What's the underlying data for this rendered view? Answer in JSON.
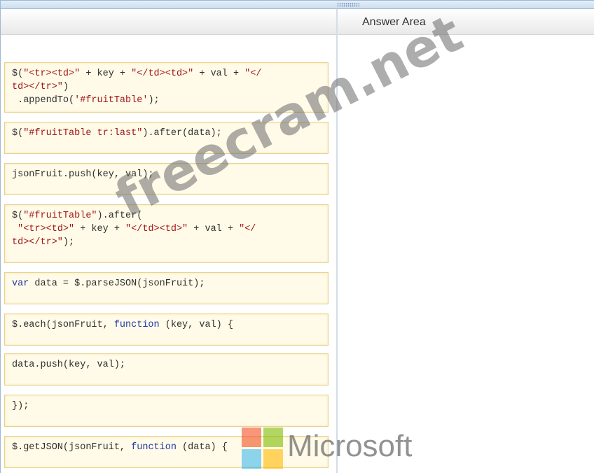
{
  "answer_area": {
    "title": "Answer Area"
  },
  "code_blocks": [
    {
      "lines": [
        [
          {
            "t": "$(",
            "c": ""
          },
          {
            "t": "\"<tr><td>\"",
            "c": "str"
          },
          {
            "t": " + key + ",
            "c": ""
          },
          {
            "t": "\"</td><td>\"",
            "c": "str"
          },
          {
            "t": " + val + ",
            "c": ""
          },
          {
            "t": "\"</",
            "c": "str"
          }
        ],
        [
          {
            "t": "td></tr>\"",
            "c": "str"
          },
          {
            "t": ")",
            "c": ""
          }
        ],
        [
          {
            "t": " .appendTo(",
            "c": ""
          },
          {
            "t": "'#fruitTable'",
            "c": "str"
          },
          {
            "t": ");",
            "c": ""
          }
        ]
      ]
    },
    {
      "lines": [
        [
          {
            "t": "$(",
            "c": ""
          },
          {
            "t": "\"#fruitTable tr:last\"",
            "c": "str"
          },
          {
            "t": ").after(data);",
            "c": ""
          }
        ]
      ]
    },
    {
      "lines": [
        [
          {
            "t": "jsonFruit.push(key, val);",
            "c": ""
          }
        ]
      ]
    },
    {
      "lines": [
        [
          {
            "t": "$(",
            "c": ""
          },
          {
            "t": "\"#fruitTable\"",
            "c": "str"
          },
          {
            "t": ").after(",
            "c": ""
          }
        ],
        [
          {
            "t": " ",
            "c": ""
          },
          {
            "t": "\"<tr><td>\"",
            "c": "str"
          },
          {
            "t": " + key + ",
            "c": ""
          },
          {
            "t": "\"</td><td>\"",
            "c": "str"
          },
          {
            "t": " + val + ",
            "c": ""
          },
          {
            "t": "\"</",
            "c": "str"
          }
        ],
        [
          {
            "t": "td></tr>\"",
            "c": "str"
          },
          {
            "t": ");",
            "c": ""
          }
        ]
      ]
    },
    {
      "lines": [
        [
          {
            "t": "var",
            "c": "kw"
          },
          {
            "t": " data = $.parseJSON(jsonFruit);",
            "c": ""
          }
        ]
      ]
    },
    {
      "lines": [
        [
          {
            "t": "$.each(jsonFruit, ",
            "c": ""
          },
          {
            "t": "function",
            "c": "kw"
          },
          {
            "t": " (key, val) {",
            "c": ""
          }
        ]
      ]
    },
    {
      "lines": [
        [
          {
            "t": "data.push(key, val);",
            "c": ""
          }
        ]
      ]
    },
    {
      "lines": [
        [
          {
            "t": "});",
            "c": ""
          }
        ]
      ]
    },
    {
      "lines": [
        [
          {
            "t": "$.getJSON(jsonFruit, ",
            "c": ""
          },
          {
            "t": "function",
            "c": "kw"
          },
          {
            "t": " (data) {",
            "c": ""
          }
        ]
      ]
    }
  ],
  "watermark": {
    "text": "freecram.net"
  },
  "brand": {
    "name": "Microsoft"
  },
  "colors": {
    "block_bg": "#fffbe8",
    "block_border": "#e9d28d",
    "string": "#a31515",
    "keyword": "#1f37a7"
  }
}
